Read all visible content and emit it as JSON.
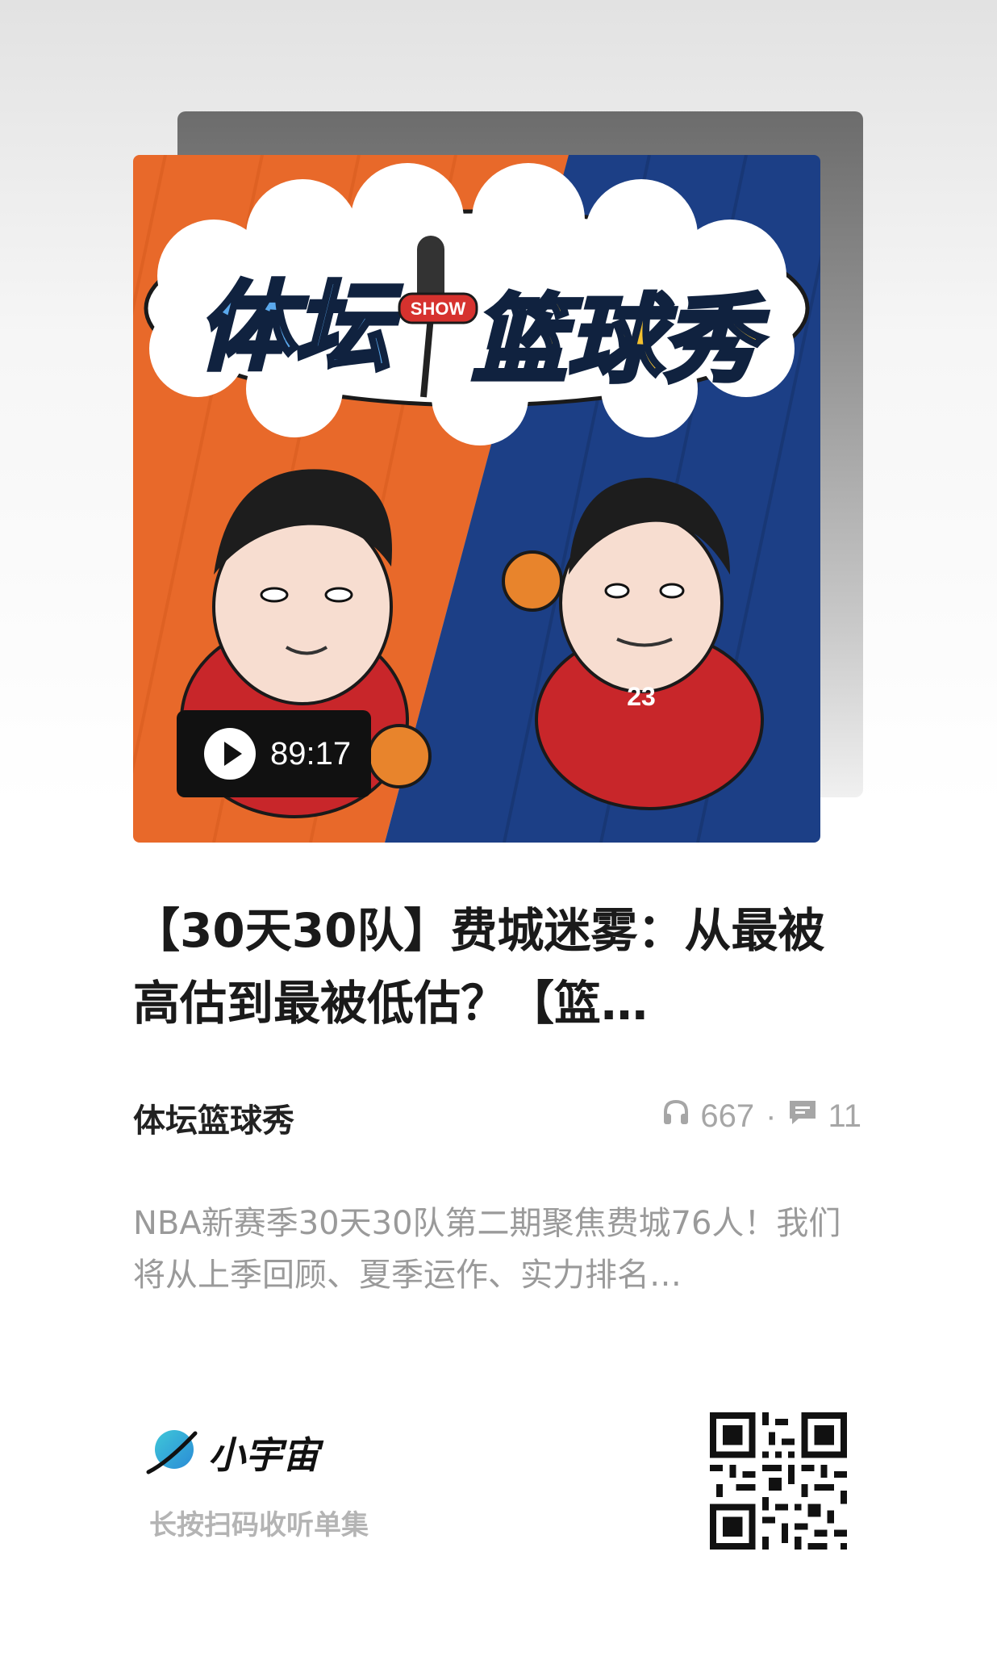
{
  "cover": {
    "brand_word_left": "体坛",
    "mic_label": "SHOW",
    "brand_word_right": "篮球秀",
    "jersey_number": "23",
    "colors": {
      "left_bg": "#e8692a",
      "right_bg": "#1c3f86",
      "title_blue": "#5aa8ec",
      "title_yellow": "#f4c12f"
    }
  },
  "player": {
    "duration": "89:17",
    "icon": "play-icon"
  },
  "episode": {
    "title": "【30天30队】费城迷雾：从最被高估到最被低估？【篮…",
    "channel": "体坛篮球秀",
    "plays": "667",
    "comments": "11",
    "description": "NBA新赛季30天30队第二期聚焦费城76人！我们将从上季回顾、夏季运作、实力排名…"
  },
  "footer": {
    "app_name": "小宇宙",
    "hint": "长按扫码收听单集"
  }
}
